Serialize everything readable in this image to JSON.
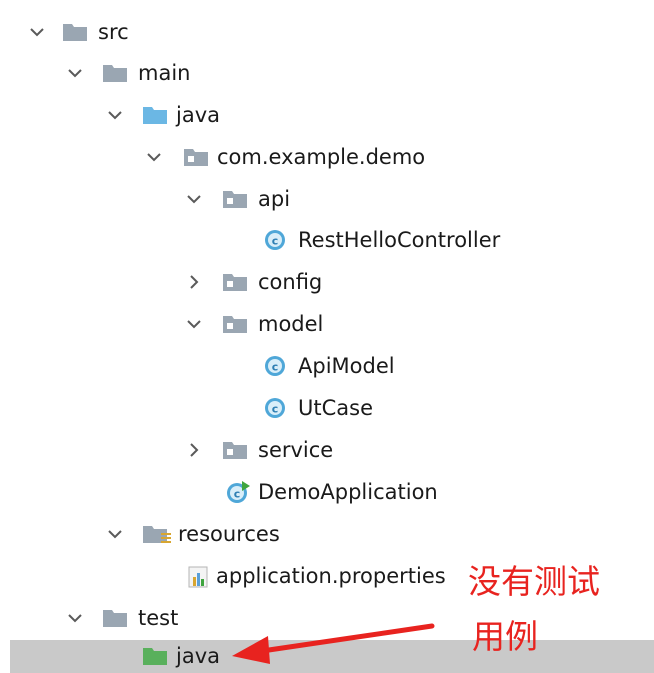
{
  "colors": {
    "folder": "#9aa6b2",
    "folder_blue": "#6bb7e4",
    "folder_green": "#59b05c",
    "class_icon": "#4fa7d8",
    "selection": "#c9c9c9",
    "annotation": "#e8231f"
  },
  "tree": {
    "nodes": [
      {
        "label": "src",
        "expanded": true,
        "icon": "folder-icon"
      },
      {
        "label": "main",
        "expanded": true,
        "icon": "folder-icon"
      },
      {
        "label": "java",
        "expanded": true,
        "icon": "source-folder-icon"
      },
      {
        "label": "com.example.demo",
        "expanded": true,
        "icon": "package-icon"
      },
      {
        "label": "api",
        "expanded": true,
        "icon": "package-icon"
      },
      {
        "label": "RestHelloController",
        "icon": "class-icon"
      },
      {
        "label": "config",
        "expanded": false,
        "icon": "package-icon"
      },
      {
        "label": "model",
        "expanded": true,
        "icon": "package-icon"
      },
      {
        "label": "ApiModel",
        "icon": "class-icon"
      },
      {
        "label": "UtCase",
        "icon": "class-icon"
      },
      {
        "label": "service",
        "expanded": false,
        "icon": "package-icon"
      },
      {
        "label": "DemoApplication",
        "icon": "spring-boot-class-icon"
      },
      {
        "label": "resources",
        "expanded": true,
        "icon": "resources-folder-icon"
      },
      {
        "label": "application.properties",
        "icon": "properties-file-icon"
      },
      {
        "label": "test",
        "expanded": true,
        "icon": "folder-icon"
      },
      {
        "label": "java",
        "selected": true,
        "icon": "test-source-folder-icon"
      }
    ]
  },
  "annotation": {
    "line1": "没有测试",
    "line2": "用例"
  }
}
